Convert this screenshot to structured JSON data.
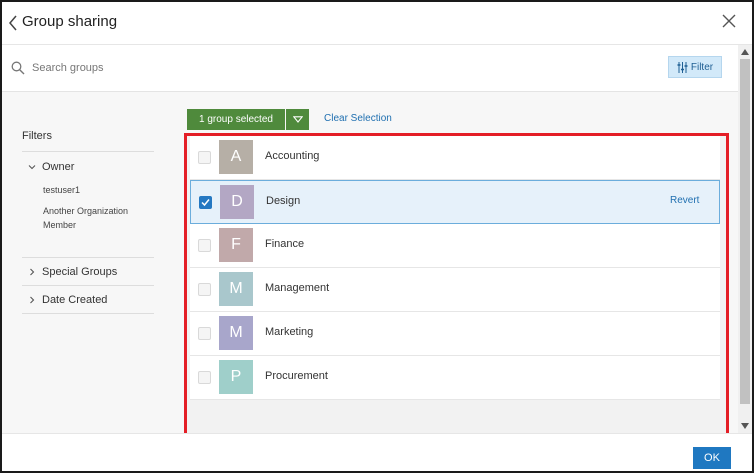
{
  "header": {
    "title": "Group sharing"
  },
  "search": {
    "placeholder": "Search groups",
    "value": ""
  },
  "toolbar": {
    "filter_label": "Filter"
  },
  "filters": {
    "title": "Filters",
    "owner": {
      "label": "Owner",
      "options": [
        "testuser1",
        "Another Organization Member"
      ]
    },
    "special_groups": {
      "label": "Special Groups"
    },
    "date_created": {
      "label": "Date Created"
    }
  },
  "selection": {
    "selected_label": "1 group selected",
    "clear_label": "Clear Selection"
  },
  "groups": [
    {
      "initial": "A",
      "name": "Accounting",
      "color": "#b6afa6",
      "checked": false
    },
    {
      "initial": "D",
      "name": "Design",
      "color": "#b3a7c4",
      "checked": true,
      "revert_label": "Revert"
    },
    {
      "initial": "F",
      "name": "Finance",
      "color": "#c1a9aa",
      "checked": false
    },
    {
      "initial": "M",
      "name": "Management",
      "color": "#a9c7cc",
      "checked": false
    },
    {
      "initial": "M",
      "name": "Marketing",
      "color": "#a8a6cb",
      "checked": false
    },
    {
      "initial": "P",
      "name": "Procurement",
      "color": "#9fcfca",
      "checked": false
    }
  ],
  "footer": {
    "ok_label": "OK"
  },
  "colors": {
    "accent": "#1f78c1",
    "selected_button": "#4f8a3c",
    "highlight_border": "#e41e26"
  }
}
